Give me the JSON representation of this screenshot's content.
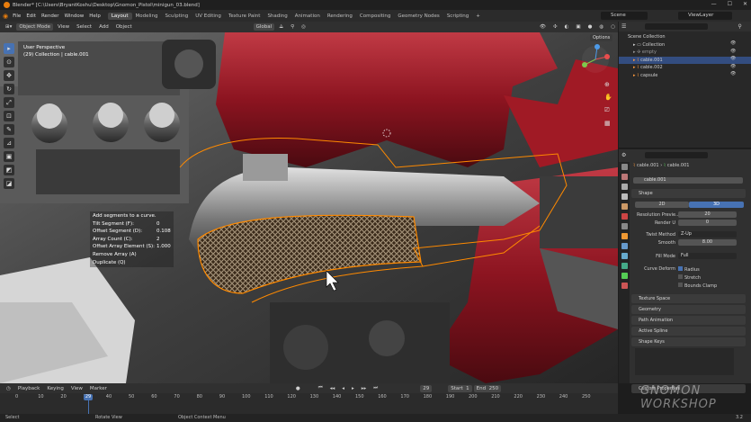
{
  "window": {
    "title": "Blender* [C:\\Users\\BryantKoshu\\Desktop\\Gnomon_Pistol\\minigun_03.blend]"
  },
  "menus": [
    "File",
    "Edit",
    "Render",
    "Window",
    "Help"
  ],
  "workspaces": [
    "Layout",
    "Modeling",
    "Sculpting",
    "UV Editing",
    "Texture Paint",
    "Shading",
    "Animation",
    "Rendering",
    "Compositing",
    "Geometry Nodes",
    "Scripting"
  ],
  "active_workspace": "Layout",
  "scene": "Scene",
  "view_layer": "ViewLayer",
  "viewport_header": {
    "mode": "Object Mode",
    "menus": [
      "View",
      "Select",
      "Add",
      "Object"
    ],
    "orientation": "Global",
    "options": "Options"
  },
  "viewport_info": {
    "line1": "User Perspective",
    "line2": "(29) Collection | cable.001"
  },
  "operator_panel": {
    "header": "Add segments to a curve.",
    "rows": [
      {
        "k": "Tilt Segment (F):",
        "v": "0"
      },
      {
        "k": "Offset Segment (D):",
        "v": "0.108"
      },
      {
        "k": "Array Count (C):",
        "v": "2"
      },
      {
        "k": "Offset Array Element (S):",
        "v": "1.000"
      },
      {
        "k": "Remove Array (A)",
        "v": ""
      },
      {
        "k": "Duplicate (Q)",
        "v": ""
      }
    ]
  },
  "outliner": {
    "root": "Scene Collection",
    "items": [
      {
        "name": "Collection",
        "selected": false
      },
      {
        "name": "empty",
        "selected": false
      },
      {
        "name": "cable.001",
        "selected": true
      },
      {
        "name": "cable.002",
        "selected": false
      },
      {
        "name": "capsule",
        "selected": false
      }
    ]
  },
  "properties": {
    "breadcrumb_obj": "cable.001",
    "breadcrumb_data": "cable.001",
    "data_name": "cable.001",
    "shape_header": "Shape",
    "dim_2d": "2D",
    "dim_3d": "3D",
    "res_preview_label": "Resolution Previe...",
    "res_preview_value": "20",
    "render_u_label": "Render U",
    "render_u_value": "0",
    "twist_method_label": "Twist Method",
    "twist_method_value": "Z-Up",
    "smooth_label": "Smooth",
    "smooth_value": "8.00",
    "fill_mode_label": "Fill Mode",
    "fill_mode_value": "Full",
    "curve_deform_label": "Curve Deform",
    "radius": "Radius",
    "stretch": "Stretch",
    "bounds_clamp": "Bounds Clamp",
    "panels": [
      "Texture Space",
      "Geometry",
      "Path Animation",
      "Active Spline",
      "Shape Keys",
      "Custom Properties"
    ]
  },
  "timeline": {
    "menus": [
      "Playback",
      "Keying",
      "View",
      "Marker"
    ],
    "current_frame": "29",
    "start_label": "Start",
    "start": "1",
    "end_label": "End",
    "end": "250",
    "ticks": [
      "0",
      "10",
      "20",
      "30",
      "40",
      "50",
      "60",
      "70",
      "80",
      "90",
      "100",
      "110",
      "120",
      "130",
      "140",
      "150",
      "160",
      "170",
      "180",
      "190",
      "200",
      "210",
      "220",
      "230",
      "240",
      "250"
    ]
  },
  "status": {
    "select": "Select",
    "rotate": "Rotate View",
    "context": "Object Context Menu",
    "version": "3.2"
  },
  "watermark": {
    "line1": "GNOMON",
    "line2": "WORKSHOP"
  },
  "colors": {
    "accent": "#4772b3",
    "selection": "#ff8a00",
    "body_red": "#a01a25"
  }
}
